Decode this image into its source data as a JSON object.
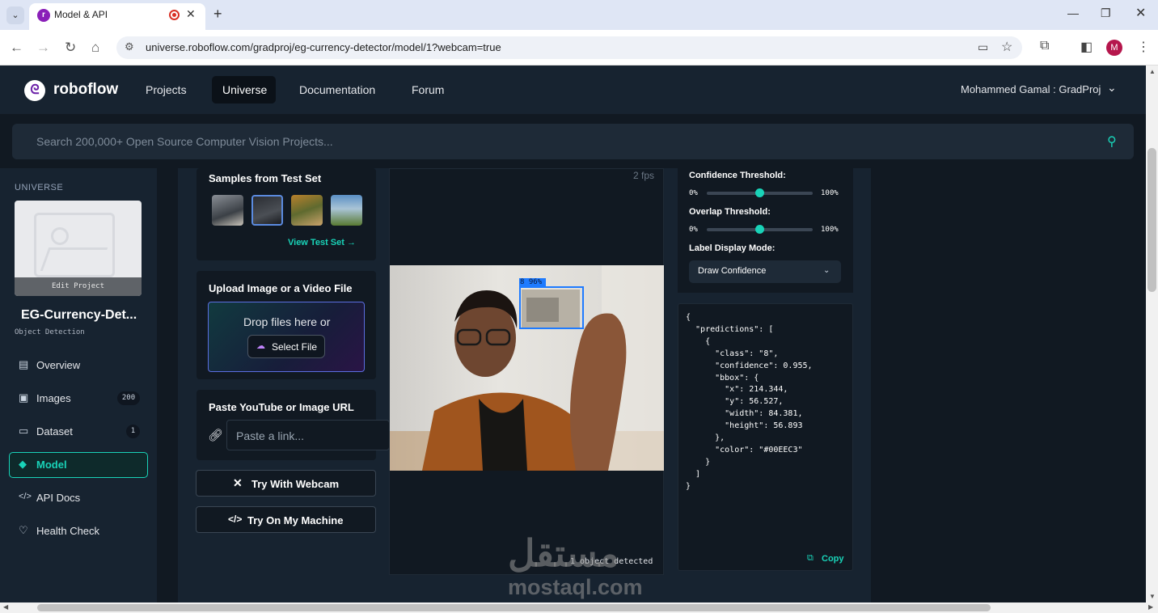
{
  "browser": {
    "tab_title": "Model & API",
    "url": "universe.roboflow.com/gradproj/eg-currency-detector/model/1?webcam=true",
    "profile_initial": "M"
  },
  "header": {
    "logo": "roboflow",
    "nav": [
      "Projects",
      "Universe",
      "Documentation",
      "Forum"
    ],
    "user": "Mohammed Gamal : GradProj"
  },
  "search": {
    "placeholder": "Search 200,000+ Open Source Computer Vision Projects..."
  },
  "sidebar": {
    "section": "UNIVERSE",
    "edit_project": "Edit Project",
    "project_name": "EG-Currency-Det...",
    "project_type": "Object Detection",
    "items": [
      {
        "label": "Overview",
        "icon": "document-icon",
        "badge": ""
      },
      {
        "label": "Images",
        "icon": "images-icon",
        "badge": "200"
      },
      {
        "label": "Dataset",
        "icon": "folder-icon",
        "badge": "1"
      },
      {
        "label": "Model",
        "icon": "model-icon",
        "badge": ""
      },
      {
        "label": "API Docs",
        "icon": "code-icon",
        "badge": ""
      },
      {
        "label": "Health Check",
        "icon": "heart-icon",
        "badge": ""
      }
    ]
  },
  "samples": {
    "title": "Samples from Test Set",
    "view_link": "View Test Set →"
  },
  "upload": {
    "title": "Upload Image or a Video File",
    "drop_text": "Drop files here or",
    "select_button": "Select File"
  },
  "url_input": {
    "title": "Paste YouTube or Image URL",
    "placeholder": "Paste a link..."
  },
  "buttons": {
    "webcam": "Try With Webcam",
    "machine": "Try On My Machine"
  },
  "video": {
    "fps": "2 fps",
    "box_label": "8 96%",
    "status": "1 object detected"
  },
  "settings": {
    "confidence_label": "Confidence Threshold:",
    "overlap_label": "Overlap Threshold:",
    "min": "0%",
    "max": "100%",
    "confidence_value": 0.5,
    "overlap_value": 0.5,
    "display_mode_label": "Label Display Mode:",
    "display_mode": "Draw Confidence"
  },
  "json_output": "{\n  \"predictions\": [\n    {\n      \"class\": \"8\",\n      \"confidence\": 0.955,\n      \"bbox\": {\n        \"x\": 214.344,\n        \"y\": 56.527,\n        \"width\": 84.381,\n        \"height\": 56.893\n      },\n      \"color\": \"#00EEC3\"\n    }\n  ]\n}",
  "copy_label": "Copy",
  "watermark": {
    "arabic": "مستقل",
    "latin": "mostaql.com"
  },
  "colors": {
    "accent": "#19d3b8",
    "bbox": "#1e7bff",
    "background": "#111922"
  }
}
